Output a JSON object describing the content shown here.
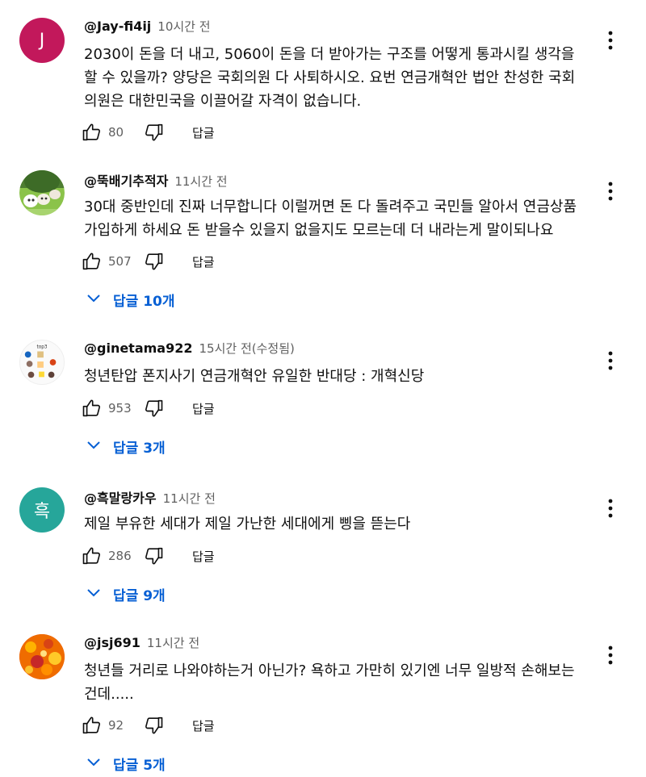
{
  "ui": {
    "reply_label": "답글",
    "more_icon": "more-vert-icon",
    "like_icon": "thumb-up-icon",
    "dislike_icon": "thumb-down-icon"
  },
  "colors": {
    "link": "#065fd4",
    "meta": "#606060"
  },
  "comments": [
    {
      "author": "@Jay-fi4ij",
      "time": "10시간 전",
      "avatar_letter": "J",
      "avatar_color": "#c2185b",
      "lines": [
        "2030이 돈을 더 내고, 5060이 돈을 더 받아가는 구조를 어떻게 통과시킬 생각을",
        "할 수 있을까? 양당은 국회의원 다 사퇴하시오. 요번 연금개혁안 법안 찬성한 국회",
        "의원은 대한민국을 이끌어갈 자격이 없습니다."
      ],
      "likes": "80",
      "replies": ""
    },
    {
      "author": "@뚝배기추적자",
      "time": "11시간 전",
      "avatar_letter": "",
      "avatar_color": "#7cb342",
      "lines": [
        "30대 중반인데 진짜 너무합니다 이럴꺼면 돈 다 돌려주고 국민들 알아서 연금상품",
        "가입하게 하세요 돈 받을수 있을지 없을지도 모르는데 더 내라는게 말이되나요"
      ],
      "likes": "507",
      "replies": "답글 10개"
    },
    {
      "author": "@ginetama922",
      "time": "15시간 전(수정됨)",
      "avatar_letter": "",
      "avatar_color": "#f5f5f5",
      "lines": [
        "청년탄압 폰지사기 연금개혁안 유일한 반대당 : 개혁신당"
      ],
      "likes": "953",
      "replies": "답글 3개"
    },
    {
      "author": "@흑말랑카우",
      "time": "11시간 전",
      "avatar_letter": "흑",
      "avatar_color": "#26a69a",
      "lines": [
        "제일 부유한 세대가 제일 가난한 세대에게 삥을 뜯는다"
      ],
      "likes": "286",
      "replies": "답글 9개"
    },
    {
      "author": "@jsj691",
      "time": "11시간 전",
      "avatar_letter": "",
      "avatar_color": "#e64a19",
      "lines": [
        "청년들 거리로 나와야하는거 아닌가? 욕하고 가만히 있기엔 너무 일방적 손해보는",
        "건데....."
      ],
      "likes": "92",
      "replies": "답글 5개"
    }
  ]
}
